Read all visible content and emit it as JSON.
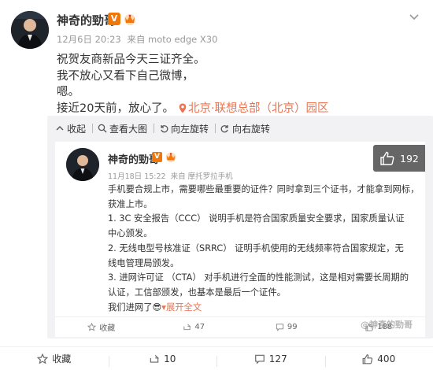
{
  "post": {
    "author": "神奇的勁哥",
    "verified_badge": "V",
    "time": "12月6日 20:23",
    "source": "来自 moto edge X30",
    "lines": [
      "祝贺友商新品今天三证齐全。",
      "我不放心又看下自己微博，",
      "嗯。",
      "接近20天前，放心了。"
    ],
    "location": "北京·联想总部（北京）园区"
  },
  "viewer_toolbar": {
    "collapse": "收起",
    "view_large": "查看大图",
    "rotate_left": "向左旋转",
    "rotate_right": "向右旋转"
  },
  "screenshot": {
    "author": "神奇的勁哥",
    "verified_badge": "V",
    "time": "11月18日 15:22",
    "source": "来自 摩托罗拉手机",
    "likes": "192",
    "lines": [
      "手机要合规上市，需要哪些最重要的证件？同时拿到三个证书，才能拿到网标，",
      "获准上市。",
      "1.      3C 安全报告（CCC）   说明手机是符合国家质量安全要求，国家质量认证",
      "中心颁发。",
      "2.      无线电型号核准证（SRRC）  证明手机使用的无线频率符合国家规定，无",
      "线电管理局颁发。",
      "3.      进网许可证 （CTA）   对手机进行全面的性能测试，这是相对需要长周期的",
      "认证，工信部颁发，也基本是最后一个证件。"
    ],
    "last_line": "我们进网了😎",
    "expand": "展开全文",
    "actions": {
      "collect": "收藏",
      "repost": "47",
      "comment": "99",
      "like": "188"
    },
    "watermark": "@神奇的勁哥"
  },
  "actions": {
    "collect": "收藏",
    "repost": "10",
    "comment": "127",
    "like": "400"
  },
  "colors": {
    "link": "#eb7350",
    "badge": "#f0780a",
    "viewer_bg": "#f2f2f5"
  }
}
